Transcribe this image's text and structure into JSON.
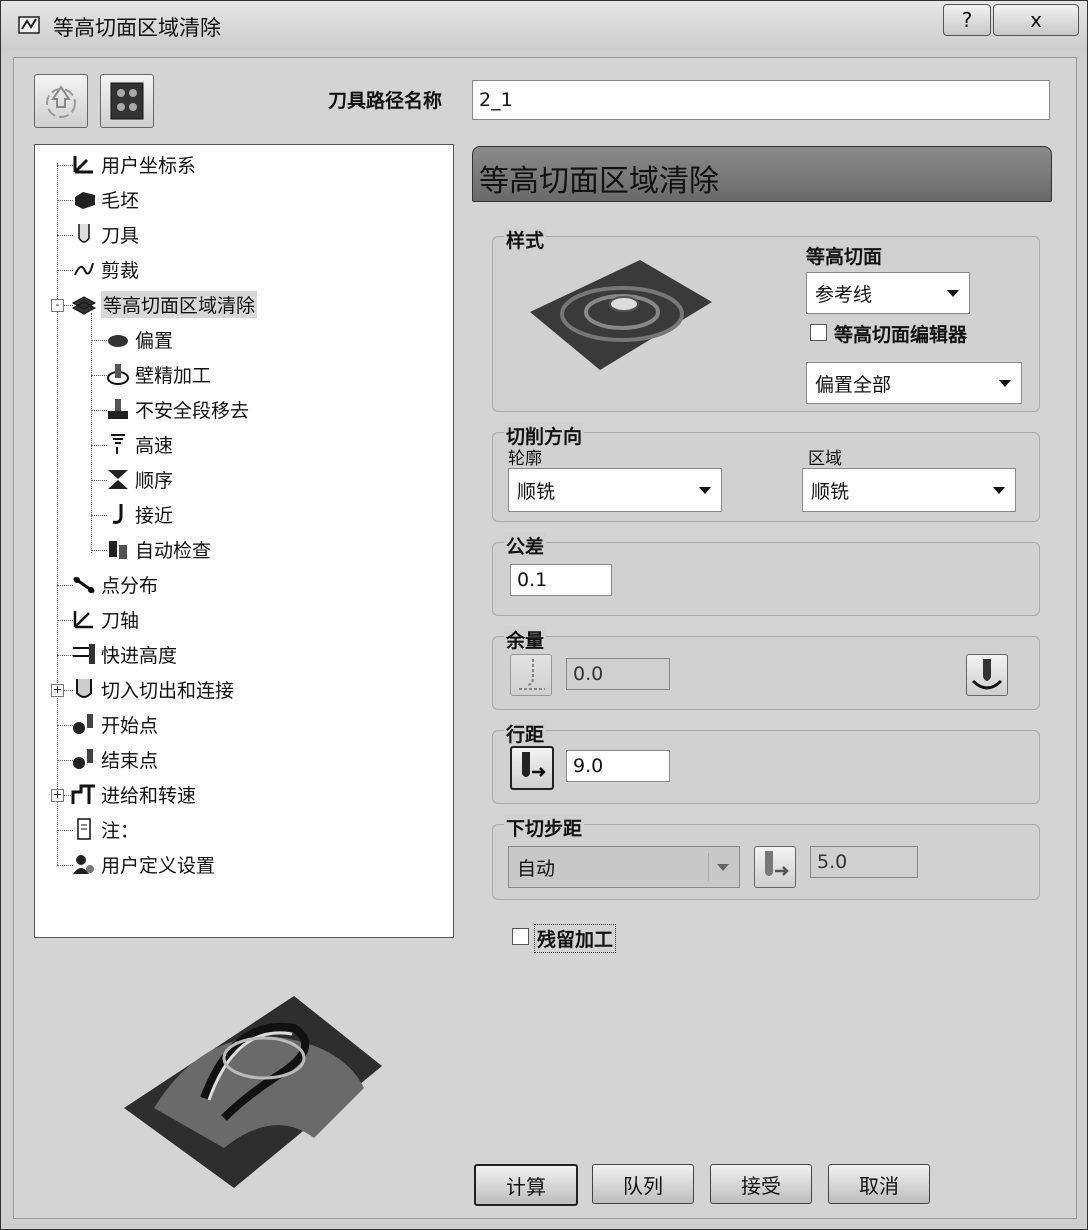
{
  "window": {
    "title": "等高切面区域清除",
    "help_label": "?",
    "close_label": "x"
  },
  "toolpath_name": {
    "label": "刀具路径名称",
    "value": "2_1"
  },
  "tree": {
    "items": [
      {
        "label": "用户坐标系",
        "icon": "ucs-icon"
      },
      {
        "label": "毛坯",
        "icon": "block-icon"
      },
      {
        "label": "刀具",
        "icon": "tool-icon"
      },
      {
        "label": "剪裁",
        "icon": "trim-icon"
      },
      {
        "label": "等高切面区域清除",
        "icon": "offset-area-clear-icon",
        "expander": "-"
      },
      {
        "label": "偏置",
        "icon": "offset-icon"
      },
      {
        "label": "壁精加工",
        "icon": "wall-finish-icon"
      },
      {
        "label": "不安全段移去",
        "icon": "unsafe-segment-icon"
      },
      {
        "label": "高速",
        "icon": "high-speed-icon"
      },
      {
        "label": "顺序",
        "icon": "order-icon"
      },
      {
        "label": "接近",
        "icon": "approach-icon"
      },
      {
        "label": "自动检查",
        "icon": "auto-verify-icon"
      },
      {
        "label": "点分布",
        "icon": "point-distribution-icon"
      },
      {
        "label": "刀轴",
        "icon": "tool-axis-icon"
      },
      {
        "label": "快进高度",
        "icon": "rapid-height-icon"
      },
      {
        "label": "切入切出和连接",
        "icon": "leads-links-icon",
        "expander": "+"
      },
      {
        "label": "开始点",
        "icon": "start-point-icon"
      },
      {
        "label": "结束点",
        "icon": "end-point-icon"
      },
      {
        "label": "进给和转速",
        "icon": "feeds-speeds-icon",
        "expander": "+"
      },
      {
        "label": "注：",
        "icon": "notes-icon"
      },
      {
        "label": "用户定义设置",
        "icon": "user-settings-icon"
      }
    ]
  },
  "panel": {
    "header": "等高切面区域清除",
    "style": {
      "title": "样式",
      "slice_label": "等高切面",
      "slice_value": "参考线",
      "editor_checkbox_label": "等高切面编辑器",
      "offset_value": "偏置全部"
    },
    "cut_direction": {
      "title": "切削方向",
      "profile_label": "轮廓",
      "profile_value": "顺铣",
      "area_label": "区域",
      "area_value": "顺铣"
    },
    "tolerance": {
      "title": "公差",
      "value": "0.1"
    },
    "thickness": {
      "title": "余量",
      "value": "0.0"
    },
    "stepover": {
      "title": "行距",
      "value": "9.0"
    },
    "stepdown": {
      "title": "下切步距",
      "mode_value": "自动",
      "value": "5.0"
    },
    "rest_machining_label": "残留加工"
  },
  "buttons": {
    "calculate": "计算",
    "queue": "队列",
    "accept": "接受",
    "cancel": "取消"
  },
  "colors": {
    "header_bar": "#7a7a7a",
    "dialog_bg": "#d4d4d4"
  }
}
